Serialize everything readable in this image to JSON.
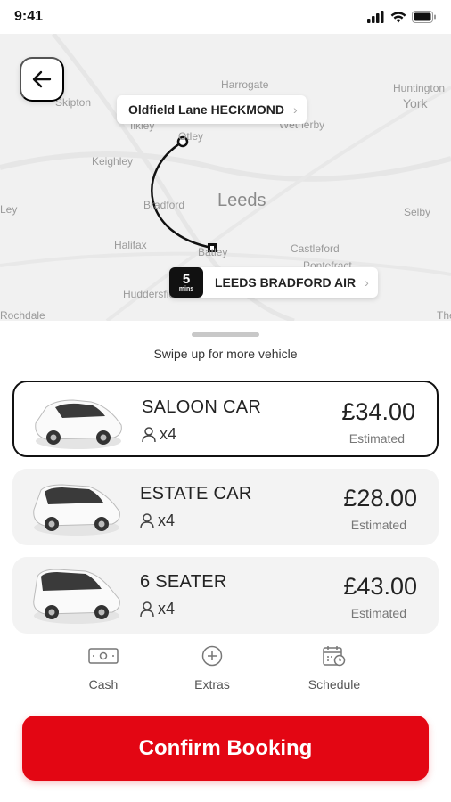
{
  "status_bar": {
    "time": "9:41"
  },
  "map": {
    "place_labels": [
      "Skipton",
      "Harrogate",
      "Huntington",
      "York",
      "Otley",
      "Wetherby",
      "Keighley",
      "Leeds",
      "Bradford",
      "Selby",
      "Halifax",
      "Batley",
      "Castleford",
      "Pontefract",
      "Huddersfield",
      "Rochdale",
      "The",
      "Ilkley",
      "Ley"
    ],
    "pickup": {
      "label": "Oldfield Lane HECKMOND"
    },
    "dropoff": {
      "label": "LEEDS BRADFORD AIR",
      "eta_value": "5",
      "eta_unit": "mins"
    }
  },
  "sheet": {
    "swipe_hint": "Swipe up for more vehicle",
    "vehicles": [
      {
        "name": "SALOON CAR",
        "seats": "x4",
        "price": "£34.00",
        "estimate_label": "Estimated",
        "selected": true
      },
      {
        "name": "ESTATE CAR",
        "seats": "x4",
        "price": "£28.00",
        "estimate_label": "Estimated",
        "selected": false
      },
      {
        "name": "6 SEATER",
        "seats": "x4",
        "price": "£43.00",
        "estimate_label": "Estimated",
        "selected": false
      }
    ],
    "options": [
      {
        "label": "Cash",
        "icon": "cash-icon"
      },
      {
        "label": "Extras",
        "icon": "plus-circle-icon"
      },
      {
        "label": "Schedule",
        "icon": "calendar-clock-icon"
      }
    ],
    "confirm_label": "Confirm Booking"
  },
  "colors": {
    "accent": "#e30613",
    "selected_border": "#111111",
    "card_bg": "#f3f3f3",
    "map_bg": "#f1f1f1"
  }
}
